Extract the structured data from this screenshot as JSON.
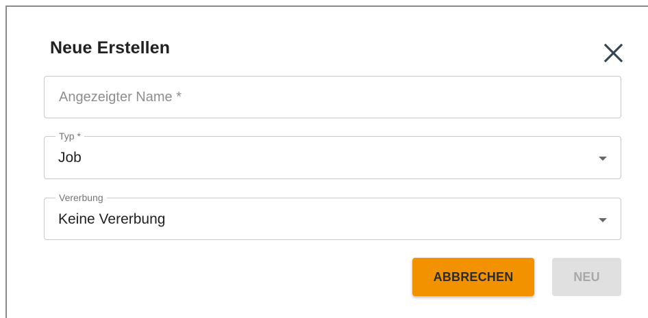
{
  "dialog": {
    "title": "Neue Erstellen",
    "close_icon": "close-icon"
  },
  "fields": {
    "name": {
      "placeholder": "Angezeigter Name *",
      "value": ""
    },
    "typ": {
      "label": "Typ *",
      "value": "Job",
      "icon": "dropdown-arrow-icon"
    },
    "vererbung": {
      "label": "Vererbung",
      "value": "Keine Vererbung",
      "icon": "dropdown-arrow-icon"
    }
  },
  "actions": {
    "cancel_label": "ABBRECHEN",
    "new_label": "NEU",
    "cancel_color": "#f39200",
    "new_disabled_color": "#e0e0e0"
  }
}
